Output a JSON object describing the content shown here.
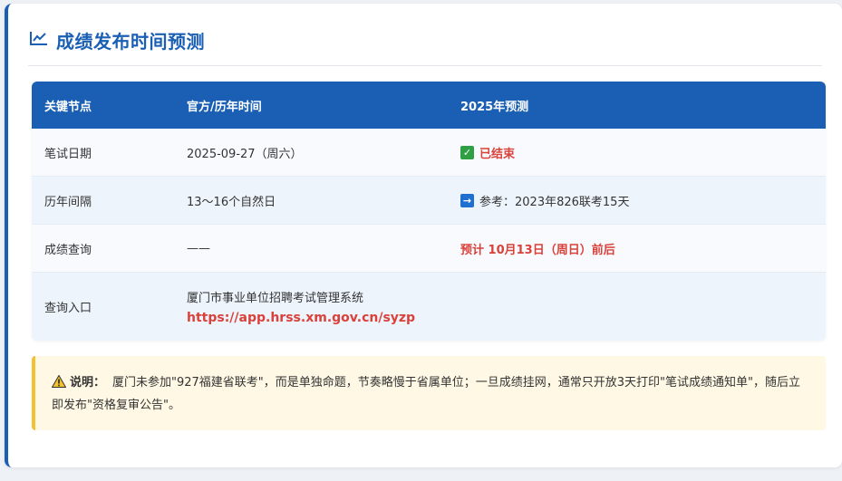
{
  "section": {
    "title": "成绩发布时间预测",
    "icon": "chart-line-icon"
  },
  "table": {
    "headers": [
      "关键节点",
      "官方/历年时间",
      "2025年预测"
    ],
    "rows": [
      {
        "node": "笔试日期",
        "time": "2025-09-27（周六）",
        "prediction": "已结束",
        "prediction_icon": "check-icon"
      },
      {
        "node": "历年间隔",
        "time": "13～16个自然日",
        "prediction": "参考：2023年826联考15天",
        "prediction_icon": "arrow-right-icon"
      },
      {
        "node": "成绩查询",
        "time": "——",
        "prediction": "预计 10月13日（周日）前后"
      },
      {
        "node": "查询入口",
        "time": "厦门市事业单位招聘考试管理系统",
        "link": "https://app.hrss.xm.gov.cn/syzp"
      }
    ]
  },
  "note": {
    "icon": "warning-icon",
    "label": "说明：",
    "text": "厦门未参加\"927福建省联考\"，而是单独命题，节奏略慢于省属单位；一旦成绩挂网，通常只开放3天打印\"笔试成绩通知单\"，随后立即发布\"资格复审公告\"。"
  },
  "colors": {
    "accent": "#1a5fb4",
    "highlight": "#d9413a",
    "note_border": "#f2c230"
  }
}
